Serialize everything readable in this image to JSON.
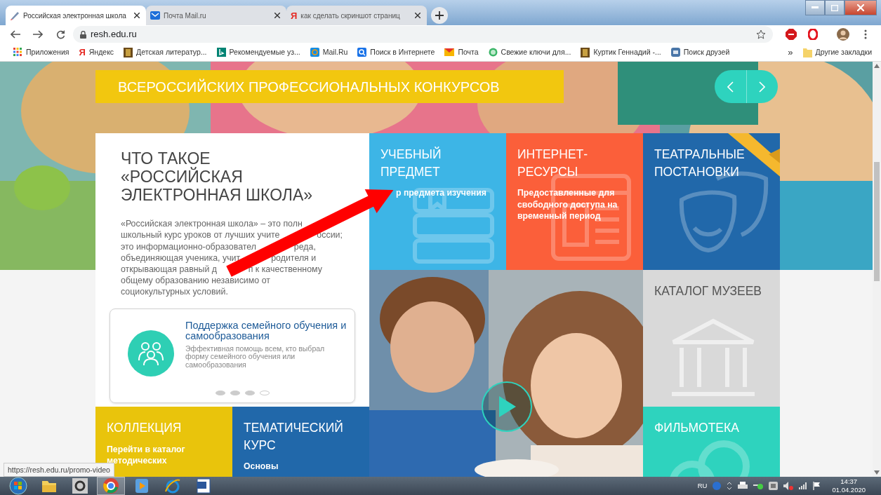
{
  "browser": {
    "tabs": [
      {
        "title": "Российская электронная школа",
        "selected": true,
        "kind": "logo"
      },
      {
        "title": "Почта Mail.ru",
        "selected": false,
        "kind": "mail"
      },
      {
        "title": "как сделать скриншот страниц",
        "selected": false,
        "kind": "glyph",
        "glyph": "Я"
      }
    ],
    "address": "resh.edu.ru",
    "bookmarks": [
      {
        "label": "Приложения",
        "kind": "apps"
      },
      {
        "label": "Яндекс",
        "kind": "glyph",
        "glyph": "Я"
      },
      {
        "label": "Детская литератур...",
        "kind": "book"
      },
      {
        "label": "Рекомендуемые уз...",
        "kind": "tile"
      },
      {
        "label": "Mail.Ru",
        "kind": "ring"
      },
      {
        "label": "Поиск в Интернете",
        "kind": "search"
      },
      {
        "label": "Почта",
        "kind": "envelope"
      },
      {
        "label": "Свежие ключи для...",
        "kind": "chat"
      },
      {
        "label": "Куртик Геннадий -...",
        "kind": "book"
      },
      {
        "label": "Поиск друзей",
        "kind": "square"
      }
    ],
    "more": "»",
    "other_bookmarks": "Другие закладки"
  },
  "page": {
    "banner_title": "ВСЕРОССИЙСКИХ ПРОФЕССИОНАЛЬНЫХ КОНКУРСОВ",
    "intro": {
      "title": "ЧТО ТАКОЕ «РОССИЙСКАЯ ЭЛЕКТРОННАЯ ШКОЛА»",
      "lines": [
        [
          "«Российская электронная школа» – это полн"
        ],
        [
          "школьный курс уроков от лучших учите",
          "оссии;"
        ],
        [
          "это информационно-образовател",
          "реда,"
        ],
        [
          "объединяющая ученика, учит",
          "родителя и"
        ],
        [
          "открывающая равный д",
          "п к качественному"
        ],
        [
          "общему образованию независимо от"
        ],
        [
          "социокультурных условий."
        ]
      ]
    },
    "promo": {
      "title": "Поддержка семейного обучения и самообразования",
      "text": "Эффективная помощь всем, кто выбрал форму семейного обучения или самообразования",
      "dots": [
        {
          "selected": false
        },
        {
          "selected": false
        },
        {
          "selected": false
        },
        {
          "selected": true
        }
      ]
    },
    "tiles": [
      {
        "kind": "subject",
        "title": "УЧЕБНЫЙ ПРЕДМЕТ",
        "text": "р предмета изучения",
        "color": "#3db5e6"
      },
      {
        "kind": "internet",
        "title": "ИНТЕРНЕТ-РЕСУРСЫ",
        "text": "Предоставленные для свободного доступа на временный период",
        "color": "#fb5f3a"
      },
      {
        "kind": "theatre",
        "title": "ТЕАТРАЛЬНЫЕ ПОСТАНОВКИ",
        "color": "#2168aa"
      },
      {
        "kind": "museums",
        "title": "КАТАЛОГ МУЗЕЕВ",
        "color": "#d9d9d9"
      },
      {
        "kind": "collection",
        "title": "КОЛЛЕКЦИЯ",
        "text": "Перейти в каталог методических",
        "color": "#e9c40c"
      },
      {
        "kind": "thematic",
        "title": "ТЕМАТИЧЕСКИЙ КУРС",
        "text": "Основы",
        "color": "#2168aa"
      },
      {
        "kind": "films",
        "title": "ФИЛЬМОТЕКА",
        "color": "#2ed3be"
      }
    ]
  },
  "status_url": "https://resh.edu.ru/promo-video",
  "taskbar": {
    "apps": [
      {
        "kind": "folder",
        "selected": false
      },
      {
        "kind": "gear",
        "selected": false
      },
      {
        "kind": "browser",
        "selected": true
      },
      {
        "kind": "player",
        "selected": false
      },
      {
        "kind": "ie",
        "selected": false
      },
      {
        "kind": "document",
        "selected": false
      }
    ],
    "lang": "RU",
    "time": "14:37",
    "date": "01.04.2020"
  }
}
